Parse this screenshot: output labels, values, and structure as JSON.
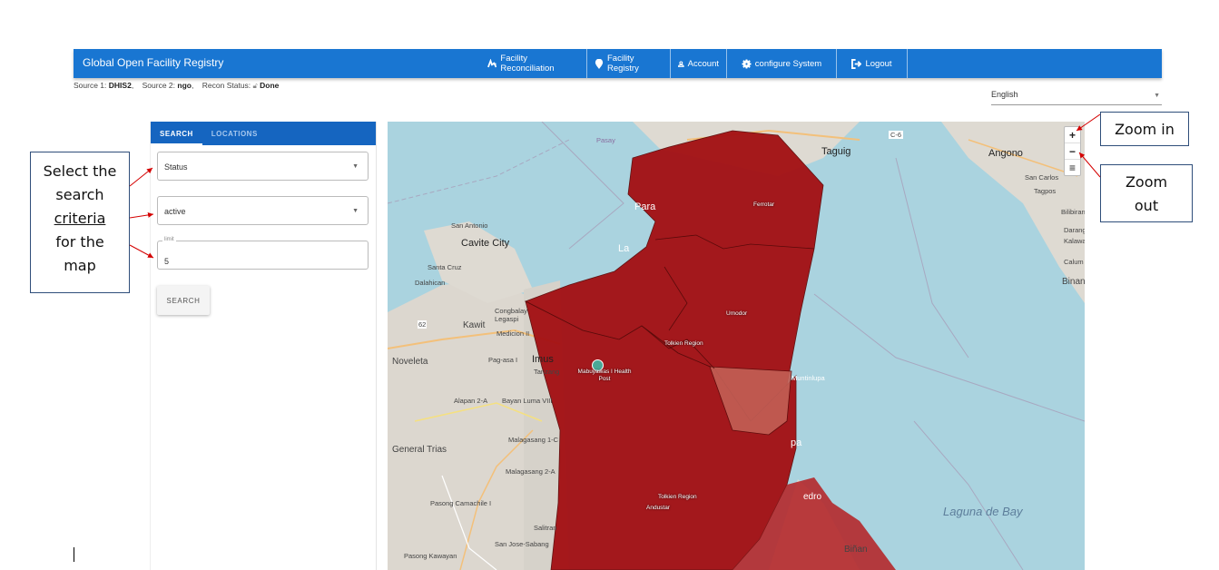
{
  "navbar": {
    "brand": "Global Open Facility Registry",
    "items": [
      {
        "label": "Facility Reconciliation",
        "icon": "reconcile-icon"
      },
      {
        "label": "Facility Registry",
        "icon": "map-pin-icon"
      },
      {
        "label": "Account",
        "icon": "person-icon"
      },
      {
        "label": "configure System",
        "icon": "gear-icon"
      },
      {
        "label": "Logout",
        "icon": "logout-icon"
      }
    ],
    "color": "#1976d2"
  },
  "status": {
    "source1_label": "Source 1:",
    "source1_value": "DHIS2",
    "source2_label": "Source 2:",
    "source2_value": "ngo",
    "recon_label": "Recon Status:",
    "recon_value": "Done",
    "recon_icon": "lock-icon"
  },
  "language": {
    "selected": "English"
  },
  "panel": {
    "tabs": [
      "SEARCH",
      "LOCATIONS"
    ],
    "active_tab": "SEARCH",
    "filter_field": "Status",
    "filter_value": "active",
    "limit_label": "limit",
    "limit_value": "5",
    "search_button": "SEARCH"
  },
  "map": {
    "labels": {
      "pasay": "Pasay",
      "taguig": "Taguig",
      "angono": "Angono",
      "c6": "C-6",
      "san_carlos": "San Carlos",
      "tagpos": "Tagpos",
      "bilibiran": "Bilibiran",
      "darangan": "Darangan",
      "kalawaan": "Kalawaan",
      "calum": "Calum",
      "binan_right": "Binan",
      "san_antonio": "San Antonio",
      "cavite_city": "Cavite City",
      "santa_cruz": "Santa Cruz",
      "dalahican": "Dalahican",
      "kawit": "Kawit",
      "noveleta": "Noveleta",
      "imus": "Imus",
      "general_trias": "General Trias",
      "alapan": "Alapan 2-A",
      "bayan_luma": "Bayan Luma VIII",
      "malagasang_1c": "Malagasang 1-C",
      "malagasang_2a": "Malagasang 2-A",
      "pasong_camachile": "Pasong Camachile I",
      "salitran": "Salitran",
      "san_jose_sabang": "San Jose-Sabang",
      "pasong_kawayan": "Pasong Kawayan",
      "tanzang": "Tanzang",
      "pag_asa": "Pag-asa I",
      "congbalay": "Congbalay Legaspi",
      "medicion": "Medicion II",
      "road_62": "62",
      "muntinlupa": "Muntinlupa",
      "laguna_de_bay": "Laguna de Bay",
      "binan": "Biñan",
      "paranaque": "Para",
      "las_pinas": "La",
      "pa": "pa",
      "san_pedro": "edro"
    },
    "regions": {
      "r1": "Ferrotar",
      "r2": "Umodor",
      "r3": "Tolkien Region",
      "r4": "Tolkien Region",
      "r4b": "Andustar"
    },
    "facility_marker": "Mabuyawas I Health Post",
    "zoom_in": "+",
    "zoom_out": "−",
    "layers": "≡",
    "region_color": "#a30f12"
  },
  "annotations": {
    "select_criteria_lines": [
      "Select the",
      "search",
      "criteria",
      "for the",
      "map"
    ],
    "zoom_in": "Zoom in",
    "zoom_out_lines": [
      "Zoom",
      "out"
    ]
  }
}
